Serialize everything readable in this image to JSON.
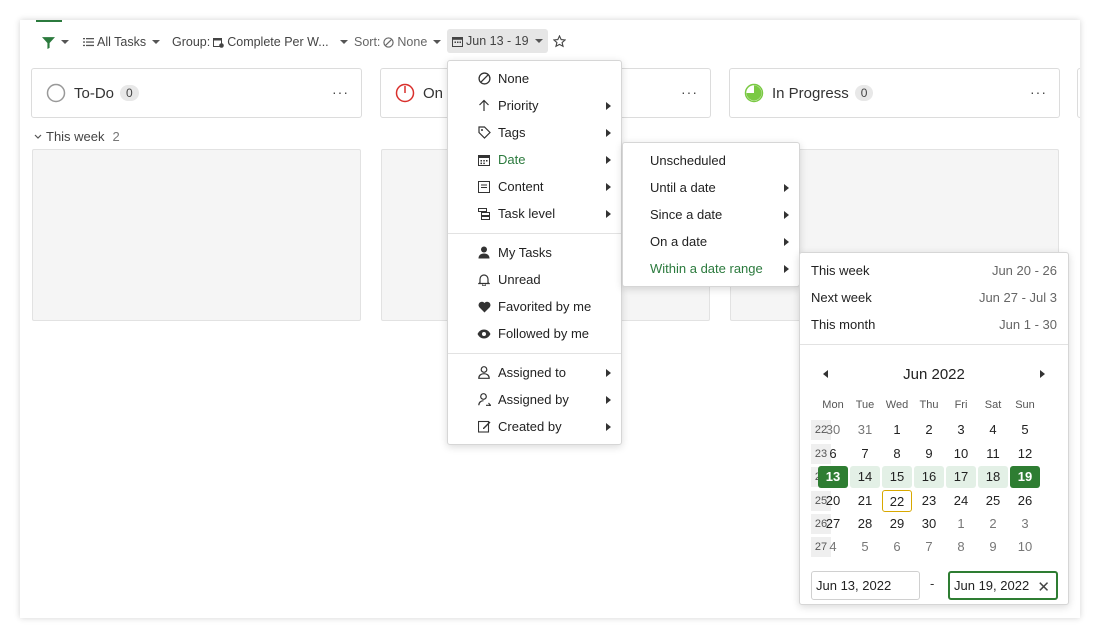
{
  "toolbar": {
    "all_tasks": "All Tasks",
    "group_prefix": "Group:",
    "group_value": "Complete Per W...",
    "sort_prefix": "Sort:",
    "sort_value": "None",
    "date_range": "Jun 13 - 19"
  },
  "columns": [
    {
      "title": "To-Do",
      "count": "0"
    },
    {
      "title": "On H",
      "count": ""
    },
    {
      "title": "In Progress",
      "count": "0"
    }
  ],
  "group": {
    "label": "This week",
    "count": "2"
  },
  "filter_menu": {
    "items": [
      {
        "label": "None",
        "icon": "none-icon"
      },
      {
        "label": "Priority",
        "icon": "arrow-up-icon"
      },
      {
        "label": "Tags",
        "icon": "tag-icon"
      },
      {
        "label": "Date",
        "icon": "calendar-icon"
      },
      {
        "label": "Content",
        "icon": "content-icon"
      },
      {
        "label": "Task level",
        "icon": "task-level-icon"
      },
      {
        "label": "My Tasks",
        "icon": "user-icon"
      },
      {
        "label": "Unread",
        "icon": "bell-icon"
      },
      {
        "label": "Favorited by me",
        "icon": "heart-icon"
      },
      {
        "label": "Followed by me",
        "icon": "eye-icon"
      },
      {
        "label": "Assigned to",
        "icon": "assigned-to-icon"
      },
      {
        "label": "Assigned by",
        "icon": "assigned-by-icon"
      },
      {
        "label": "Created by",
        "icon": "created-by-icon"
      }
    ]
  },
  "date_menu": {
    "items": [
      {
        "label": "Unscheduled"
      },
      {
        "label": "Until a date"
      },
      {
        "label": "Since a date"
      },
      {
        "label": "On a date"
      },
      {
        "label": "Within a date range"
      }
    ]
  },
  "range_panel": {
    "presets": [
      {
        "label": "This week",
        "value": "Jun 20 - 26"
      },
      {
        "label": "Next week",
        "value": "Jun 27 - Jul 3"
      },
      {
        "label": "This month",
        "value": "Jun 1 - 30"
      }
    ],
    "month": "Jun 2022",
    "weekdays": [
      "Mon",
      "Tue",
      "Wed",
      "Thu",
      "Fri",
      "Sat",
      "Sun"
    ],
    "weeks": [
      {
        "num": "22",
        "days": [
          "30",
          "31",
          "1",
          "2",
          "3",
          "4",
          "5"
        ]
      },
      {
        "num": "23",
        "days": [
          "6",
          "7",
          "8",
          "9",
          "10",
          "11",
          "12"
        ]
      },
      {
        "num": "24",
        "days": [
          "13",
          "14",
          "15",
          "16",
          "17",
          "18",
          "19"
        ]
      },
      {
        "num": "25",
        "days": [
          "20",
          "21",
          "22",
          "23",
          "24",
          "25",
          "26"
        ]
      },
      {
        "num": "26",
        "days": [
          "27",
          "28",
          "29",
          "30",
          "1",
          "2",
          "3"
        ]
      },
      {
        "num": "27",
        "days": [
          "4",
          "5",
          "6",
          "7",
          "8",
          "9",
          "10"
        ]
      }
    ],
    "start_date": "Jun 13, 2022",
    "end_date": "Jun 19, 2022",
    "separator": "-"
  },
  "colors": {
    "accent": "#2e7d32",
    "highlight": "#cc1f1f",
    "today": "#d8a800"
  }
}
